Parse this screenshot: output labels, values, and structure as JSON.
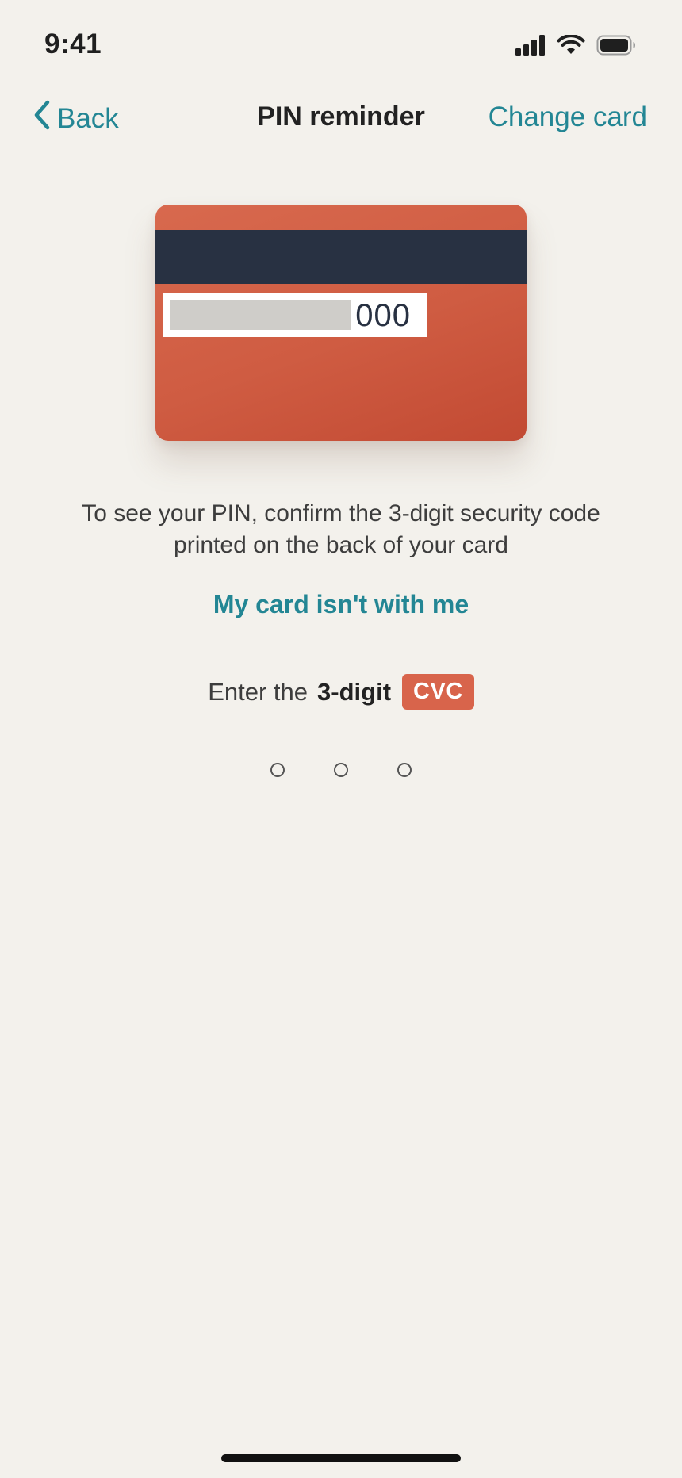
{
  "status_bar": {
    "time": "9:41",
    "icons": [
      "cellular-signal-icon",
      "wifi-icon",
      "battery-icon"
    ]
  },
  "nav": {
    "back_label": "Back",
    "title": "PIN reminder",
    "change_card_label": "Change card"
  },
  "card": {
    "cvc_display": "000",
    "colors": {
      "card": "#d8644b",
      "stripe": "#283142"
    }
  },
  "instruction": "To see your PIN, confirm the 3-digit security code printed on the back of your card",
  "no_card_link": "My card isn't with me",
  "cvc_prompt": {
    "prefix": "Enter the",
    "bold": "3-digit",
    "badge": "CVC"
  },
  "pin_entry": {
    "digits_total": 3,
    "digits_filled": 0
  },
  "colors": {
    "accent": "#238694",
    "background": "#f3f1ec",
    "badge": "#d8644b"
  }
}
